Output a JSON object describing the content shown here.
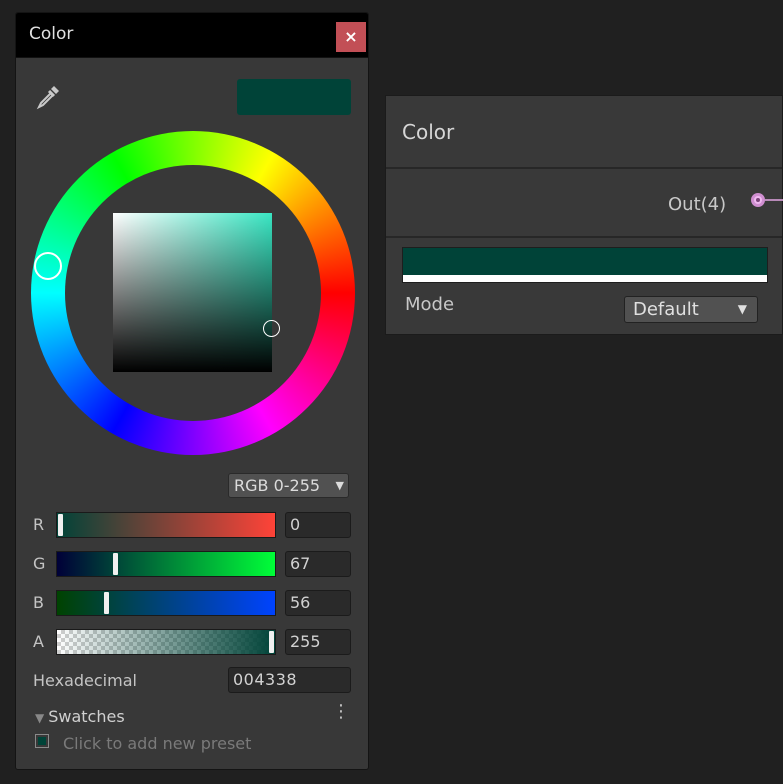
{
  "picker": {
    "title": "Color",
    "close_glyph": "×",
    "eyedropper_icon": "eyedropper-icon",
    "current_color": "#004338",
    "mode_value": "RGB 0-255",
    "mode_arrow": "▼",
    "channels": [
      {
        "label": "R",
        "value": "0",
        "fraction": 0.0,
        "from": "#004338",
        "to": "#ff4338"
      },
      {
        "label": "G",
        "value": "67",
        "fraction": 0.263,
        "from": "#000038",
        "to": "#00ff38"
      },
      {
        "label": "B",
        "value": "56",
        "fraction": 0.22,
        "from": "#004300",
        "to": "#0043ff"
      },
      {
        "label": "A",
        "value": "255",
        "fraction": 1.0,
        "from": "#004338",
        "to": "#004338"
      }
    ],
    "hex_label": "Hexadecimal",
    "hex_value": "004338",
    "swatches_label": "Swatches",
    "swatches_tri": "▼",
    "kebab_glyph": "⋮",
    "preset_hint": "Click to add new preset"
  },
  "node": {
    "title": "Color",
    "output_label": "Out(4)",
    "color_value": "#004338",
    "mode_label": "Mode",
    "mode_value": "Default",
    "mode_arrow": "▼",
    "port_color": "#f0b8f0"
  }
}
